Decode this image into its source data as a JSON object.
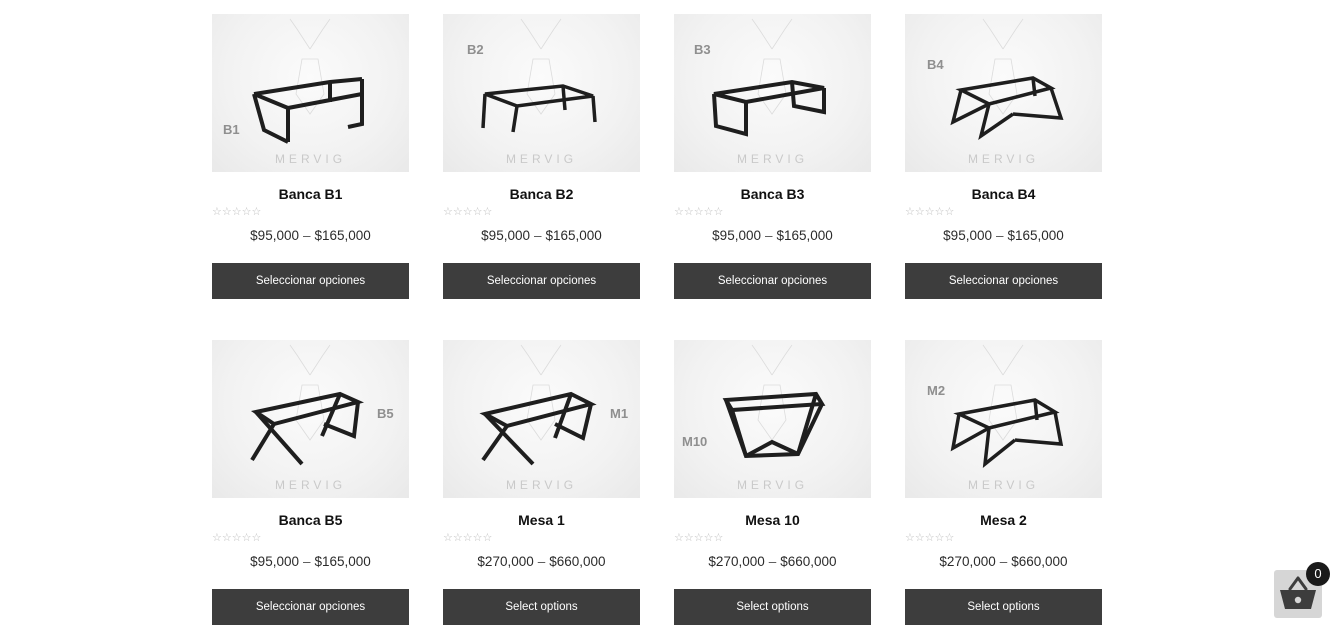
{
  "products": [
    {
      "title": "Banca B1",
      "code": "B1",
      "watermark": "MERVIG",
      "rating_stars": "☆☆☆☆☆",
      "rating_value": 0,
      "price_min": "$95,000",
      "price_sep": "–",
      "price_max": "$165,000",
      "button_label": "Seleccionar opciones"
    },
    {
      "title": "Banca B2",
      "code": "B2",
      "watermark": "MERVIG",
      "rating_stars": "☆☆☆☆☆",
      "rating_value": 0,
      "price_min": "$95,000",
      "price_sep": "–",
      "price_max": "$165,000",
      "button_label": "Seleccionar opciones"
    },
    {
      "title": "Banca B3",
      "code": "B3",
      "watermark": "MERVIG",
      "rating_stars": "☆☆☆☆☆",
      "rating_value": 0,
      "price_min": "$95,000",
      "price_sep": "–",
      "price_max": "$165,000",
      "button_label": "Seleccionar opciones"
    },
    {
      "title": "Banca B4",
      "code": "B4",
      "watermark": "MERVIG",
      "rating_stars": "☆☆☆☆☆",
      "rating_value": 0,
      "price_min": "$95,000",
      "price_sep": "–",
      "price_max": "$165,000",
      "button_label": "Seleccionar opciones"
    },
    {
      "title": "Banca B5",
      "code": "B5",
      "watermark": "MERVIG",
      "rating_stars": "☆☆☆☆☆",
      "rating_value": 0,
      "price_min": "$95,000",
      "price_sep": "–",
      "price_max": "$165,000",
      "button_label": "Seleccionar opciones"
    },
    {
      "title": "Mesa 1",
      "code": "M1",
      "watermark": "MERVIG",
      "rating_stars": "☆☆☆☆☆",
      "rating_value": 0,
      "price_min": "$270,000",
      "price_sep": "–",
      "price_max": "$660,000",
      "button_label": "Select options"
    },
    {
      "title": "Mesa 10",
      "code": "M10",
      "watermark": "MERVIG",
      "rating_stars": "☆☆☆☆☆",
      "rating_value": 0,
      "price_min": "$270,000",
      "price_sep": "–",
      "price_max": "$660,000",
      "button_label": "Select options"
    },
    {
      "title": "Mesa 2",
      "code": "M2",
      "watermark": "MERVIG",
      "rating_stars": "☆☆☆☆☆",
      "rating_value": 0,
      "price_min": "$270,000",
      "price_sep": "–",
      "price_max": "$660,000",
      "button_label": "Select options"
    }
  ],
  "cart": {
    "count": "0",
    "icon": "basket-icon"
  },
  "colors": {
    "button_bg": "#3d3d3d",
    "button_text": "#ffffff",
    "star_empty": "#bdbdbd",
    "cart_badge": "#1a1a1a"
  }
}
